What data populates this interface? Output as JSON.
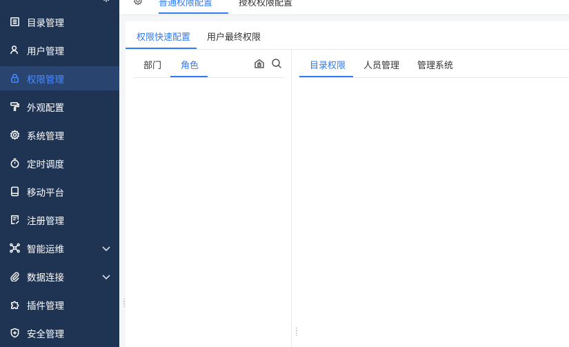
{
  "sidebar": {
    "items": [
      {
        "label": "目录管理",
        "icon": "catalog-icon"
      },
      {
        "label": "用户管理",
        "icon": "user-icon"
      },
      {
        "label": "权限管理",
        "icon": "lock-icon",
        "active": true
      },
      {
        "label": "外观配置",
        "icon": "paint-roller-icon"
      },
      {
        "label": "系统管理",
        "icon": "gear-icon"
      },
      {
        "label": "定时调度",
        "icon": "timer-icon"
      },
      {
        "label": "移动平台",
        "icon": "mobile-icon"
      },
      {
        "label": "注册管理",
        "icon": "register-icon"
      },
      {
        "label": "智能运维",
        "icon": "network-icon",
        "expandable": true
      },
      {
        "label": "数据连接",
        "icon": "paperclip-icon",
        "expandable": true
      },
      {
        "label": "插件管理",
        "icon": "puzzle-icon"
      },
      {
        "label": "安全管理",
        "icon": "shield-icon"
      }
    ],
    "accent": "#4a8cff",
    "bg": "#1f3353"
  },
  "top_tabs": [
    {
      "label": "普通权限配置",
      "active": true
    },
    {
      "label": "授权权限配置"
    }
  ],
  "sub_tabs": [
    {
      "label": "权限快速配置",
      "active": true
    },
    {
      "label": "用户最终权限"
    }
  ],
  "left_tabs": [
    {
      "label": "部门"
    },
    {
      "label": "角色",
      "active": true
    }
  ],
  "right_tabs": [
    {
      "label": "目录权限",
      "active": true
    },
    {
      "label": "人员管理"
    },
    {
      "label": "管理系统"
    }
  ],
  "colors": {
    "primary": "#2f7bf5"
  }
}
